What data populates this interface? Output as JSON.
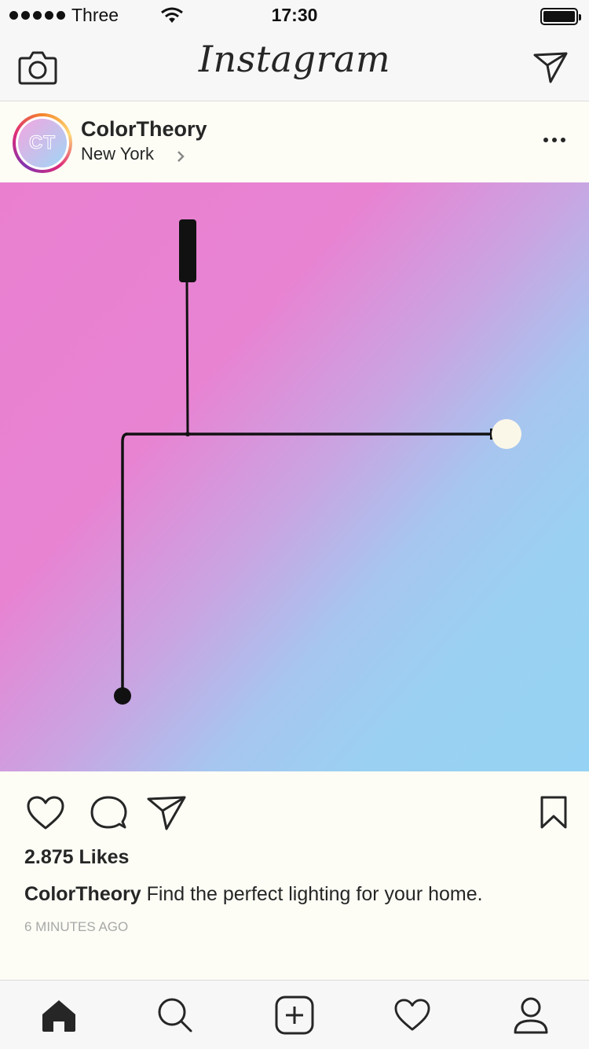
{
  "status_bar": {
    "carrier": "Three",
    "time": "17:30"
  },
  "nav": {
    "logo": "Instagram"
  },
  "post": {
    "username": "ColorTheory",
    "location": "New York",
    "avatar_initials": "CT",
    "likes": "2.875 Likes",
    "caption_user": "ColorTheory",
    "caption_text": " Find the perfect lighting for your home.",
    "timestamp": "6 MINUTES AGO"
  },
  "colors": {
    "image_pink": "#ea7fd0",
    "image_blue": "#96d2f3",
    "bulb": "#fbf7e8",
    "text": "#262626",
    "muted": "#a8a8a8"
  },
  "icons": {
    "nav_left": "camera-icon",
    "nav_right": "send-icon",
    "actions": [
      "heart-icon",
      "comment-icon",
      "send-icon",
      "bookmark-icon"
    ],
    "tabs": [
      "home-icon",
      "search-icon",
      "add-icon",
      "heart-icon",
      "profile-icon"
    ]
  }
}
